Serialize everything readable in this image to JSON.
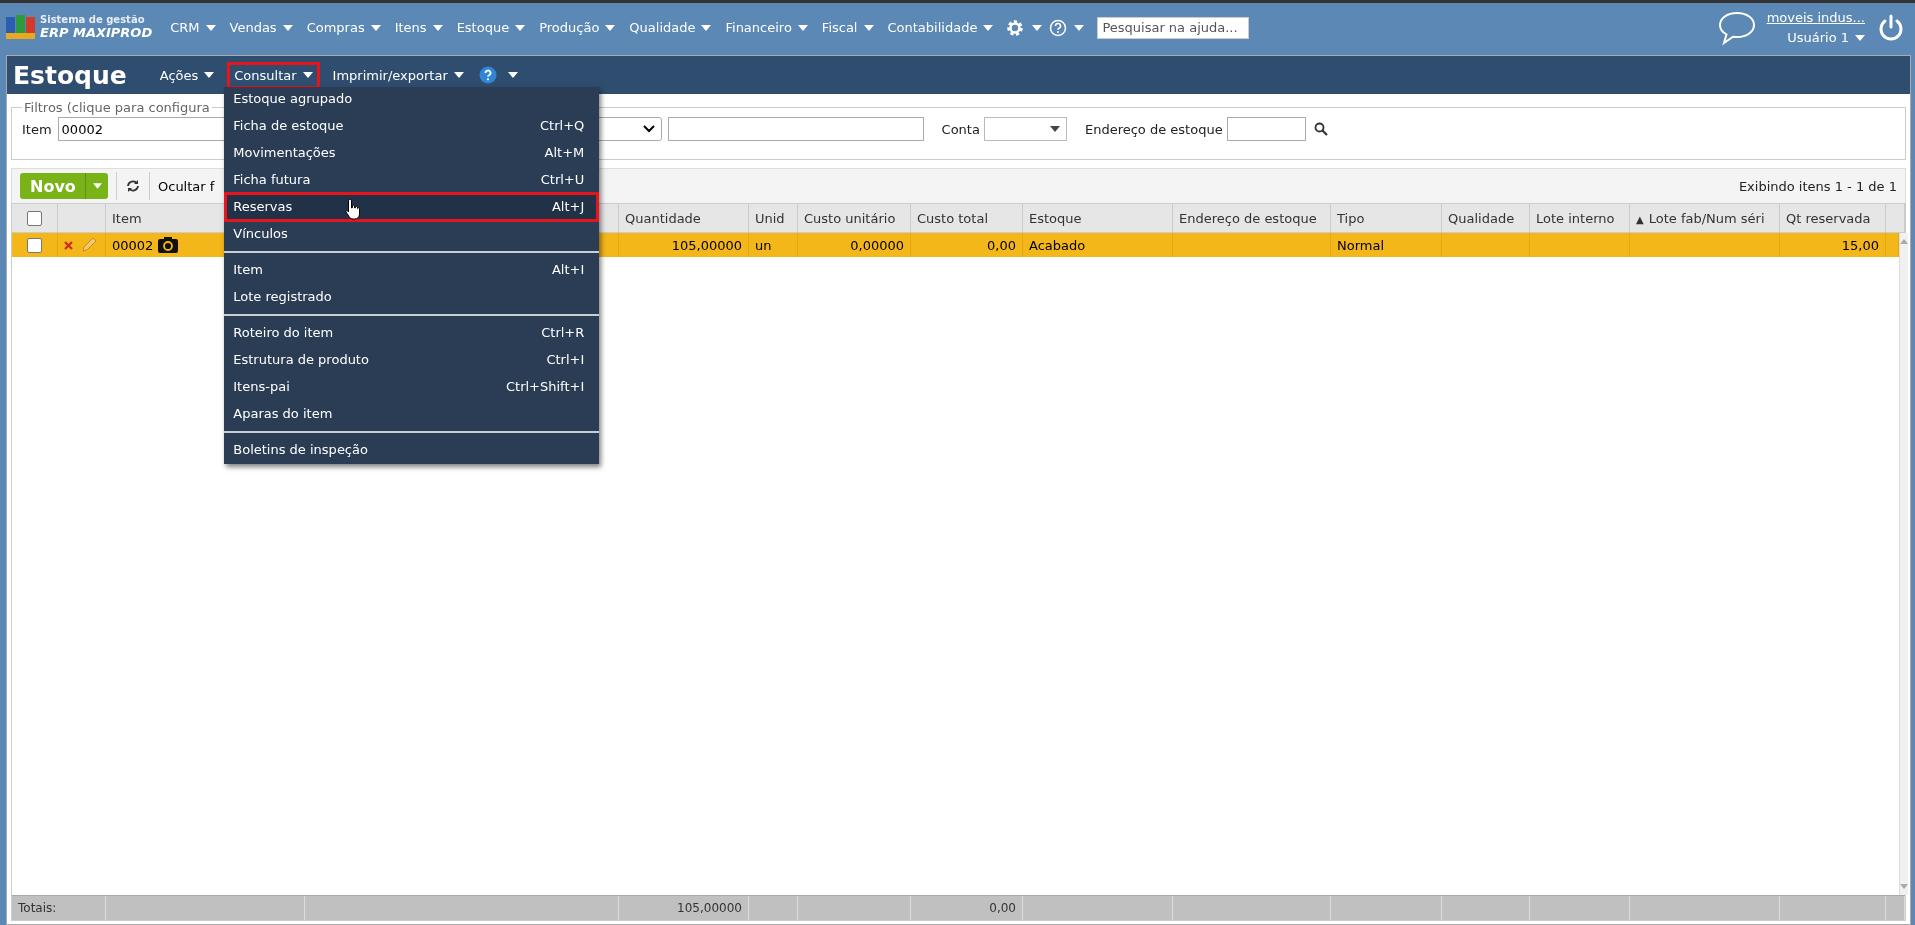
{
  "app": {
    "logo_line1": "Sistema de gestão",
    "logo_line2": "ERP MAXIPROD"
  },
  "nav_menu": [
    {
      "label": "CRM"
    },
    {
      "label": "Vendas"
    },
    {
      "label": "Compras"
    },
    {
      "label": "Itens"
    },
    {
      "label": "Estoque"
    },
    {
      "label": "Produção"
    },
    {
      "label": "Qualidade"
    },
    {
      "label": "Financeiro"
    },
    {
      "label": "Fiscal"
    },
    {
      "label": "Contabilidade"
    }
  ],
  "help_search": {
    "placeholder": "Pesquisar na ajuda..."
  },
  "user": {
    "company": "moveis indus...",
    "name": "Usuário 1"
  },
  "page": {
    "title": "Estoque"
  },
  "toolbar_menus": [
    {
      "label": "Ações",
      "selected": false
    },
    {
      "label": "Consultar",
      "selected": true
    },
    {
      "label": "Imprimir/exportar",
      "selected": false
    }
  ],
  "filters": {
    "legend": "Filtros (clique para configura",
    "item_label": "Item",
    "item_value": "00002",
    "conta_label": "Conta",
    "endereco_label": "Endereço de estoque"
  },
  "actions": {
    "new_button": "Novo",
    "hide_filters": "Ocultar f",
    "paging": "Exibindo itens 1 - 1 de 1"
  },
  "table": {
    "all_checked": false,
    "columns": [
      {
        "label": "Item",
        "kind": "text"
      },
      {
        "label": "Quantidade",
        "kind": "number"
      },
      {
        "label": "Unid",
        "kind": "text"
      },
      {
        "label": "Custo unitário",
        "kind": "number"
      },
      {
        "label": "Custo total",
        "kind": "number"
      },
      {
        "label": "Estoque",
        "kind": "text"
      },
      {
        "label": "Endereço de estoque",
        "kind": "text"
      },
      {
        "label": "Tipo",
        "kind": "text"
      },
      {
        "label": "Qualidade",
        "kind": "text"
      },
      {
        "label": "Lote interno",
        "kind": "text"
      },
      {
        "label": "Lote fab/Num séri",
        "kind": "text",
        "sort_mark": "▲"
      },
      {
        "label": "Qt reservada",
        "kind": "number"
      }
    ],
    "rows": [
      {
        "selected": true,
        "checked": false,
        "cells": [
          "00002",
          "105,00000",
          "un",
          "0,00000",
          "0,00",
          "Acabado",
          null,
          "Normal",
          null,
          null,
          null,
          "15,00"
        ]
      }
    ],
    "totals": {
      "label": "Totais:",
      "cells": [
        null,
        "105,00000",
        null,
        null,
        "0,00",
        null,
        null,
        null,
        null,
        null,
        null,
        null
      ]
    }
  },
  "dropdown": {
    "groups": [
      [
        {
          "label": "Estoque agrupado",
          "selected": false
        },
        {
          "label": "Ficha de estoque",
          "shortcut": "Ctrl+Q",
          "selected": false
        },
        {
          "label": "Movimentações",
          "shortcut": "Alt+M",
          "selected": false
        },
        {
          "label": "Ficha futura",
          "shortcut": "Ctrl+U",
          "selected": false
        },
        {
          "label": "Reservas",
          "shortcut": "Alt+J",
          "selected": true
        },
        {
          "label": "Vínculos",
          "selected": false
        }
      ],
      [
        {
          "label": "Item",
          "shortcut": "Alt+I",
          "selected": false
        },
        {
          "label": "Lote registrado",
          "selected": false
        }
      ],
      [
        {
          "label": "Roteiro do item",
          "shortcut": "Ctrl+R",
          "selected": false
        },
        {
          "label": "Estrutura de produto",
          "shortcut": "Ctrl+I",
          "selected": false
        },
        {
          "label": "Itens-pai",
          "shortcut": "Ctrl+Shift+I",
          "selected": false
        },
        {
          "label": "Aparas do item",
          "selected": false
        }
      ],
      [
        {
          "label": "Boletins de inspeção",
          "selected": false
        }
      ]
    ]
  }
}
